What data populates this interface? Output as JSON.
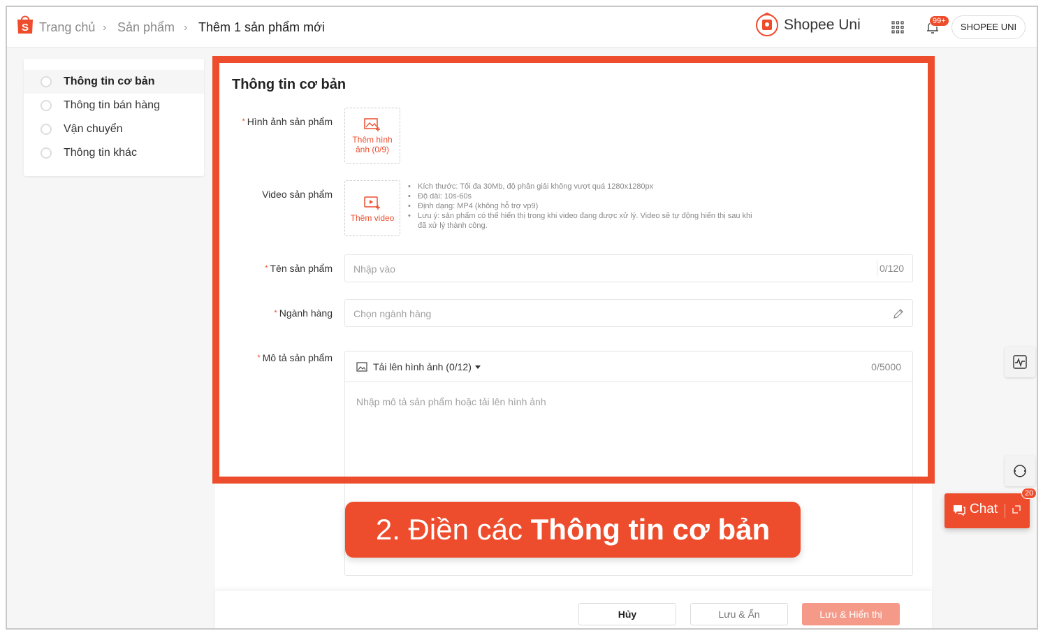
{
  "header": {
    "breadcrumb": [
      "Trang chủ",
      "Sản phẩm",
      "Thêm 1 sản phẩm mới"
    ],
    "brand": "Shopee Uni",
    "notification_count": "99+",
    "account_label": "SHOPEE UNI"
  },
  "sidebar": {
    "steps": [
      {
        "label": "Thông tin cơ bản"
      },
      {
        "label": "Thông tin bán hàng"
      },
      {
        "label": "Vận chuyển"
      },
      {
        "label": "Thông tin khác"
      }
    ]
  },
  "form": {
    "section_title": "Thông tin cơ bản",
    "images": {
      "label": "Hình ảnh sản phẩm",
      "add_label": "Thêm hình ảnh (0/9)"
    },
    "video": {
      "label": "Video sản phẩm",
      "add_label": "Thêm video",
      "notes": [
        "Kích thước: Tối đa 30Mb, độ phân giải không vượt quá 1280x1280px",
        "Độ dài: 10s-60s",
        "Định dạng: MP4 (không hỗ trợ vp9)",
        "Lưu ý: sản phẩm có thể hiển thị trong khi video đang được xử lý. Video sẽ tự động hiển thị sau khi đã xử lý thành công."
      ]
    },
    "name": {
      "label": "Tên sản phẩm",
      "placeholder": "Nhập vào",
      "count": "0/120"
    },
    "category": {
      "label": "Ngành hàng",
      "placeholder": "Chọn ngành hàng"
    },
    "description": {
      "label": "Mô tả sản phẩm",
      "upload_label": "Tải lên hình ảnh (0/12)",
      "count": "0/5000",
      "placeholder": "Nhập mô tả sản phẩm hoặc tải lên hình ảnh"
    }
  },
  "footer": {
    "cancel": "Hủy",
    "save_hide": "Lưu & Ẩn",
    "save_show": "Lưu & Hiển thị"
  },
  "annotation": {
    "prefix": "2. Điền các ",
    "emphasis": "Thông tin cơ bản"
  },
  "chat": {
    "label": "Chat",
    "count": "20"
  },
  "colors": {
    "accent": "#ee4d2d"
  }
}
